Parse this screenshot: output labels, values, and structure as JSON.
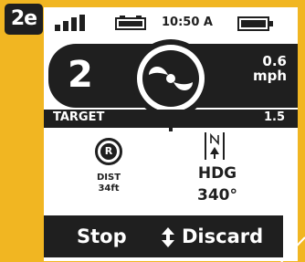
{
  "step_tag": "2e",
  "status_bar": {
    "time": "10:50 A",
    "icons": [
      "signal-bars-icon",
      "camera-battery-icon",
      "battery-icon"
    ]
  },
  "nav": {
    "speed_level": "2",
    "speed_value": "0.6",
    "speed_unit": "mph",
    "target_label": "TARGET",
    "target_value": "1.5",
    "dial_icon": "propeller-icon"
  },
  "route": {
    "badge_letter": "R",
    "dist_label": "DIST",
    "dist_value": "34ft"
  },
  "heading": {
    "icon": "north-arrow-icon",
    "label": "HDG",
    "value": "340°"
  },
  "actions": {
    "stop_label": "Stop",
    "discard_label": "Discard",
    "toggle_icon": "up-down-arrows-icon"
  },
  "colors": {
    "frame": "#f1b622",
    "screen": "#ffffff",
    "dark": "#1f1f1f"
  }
}
